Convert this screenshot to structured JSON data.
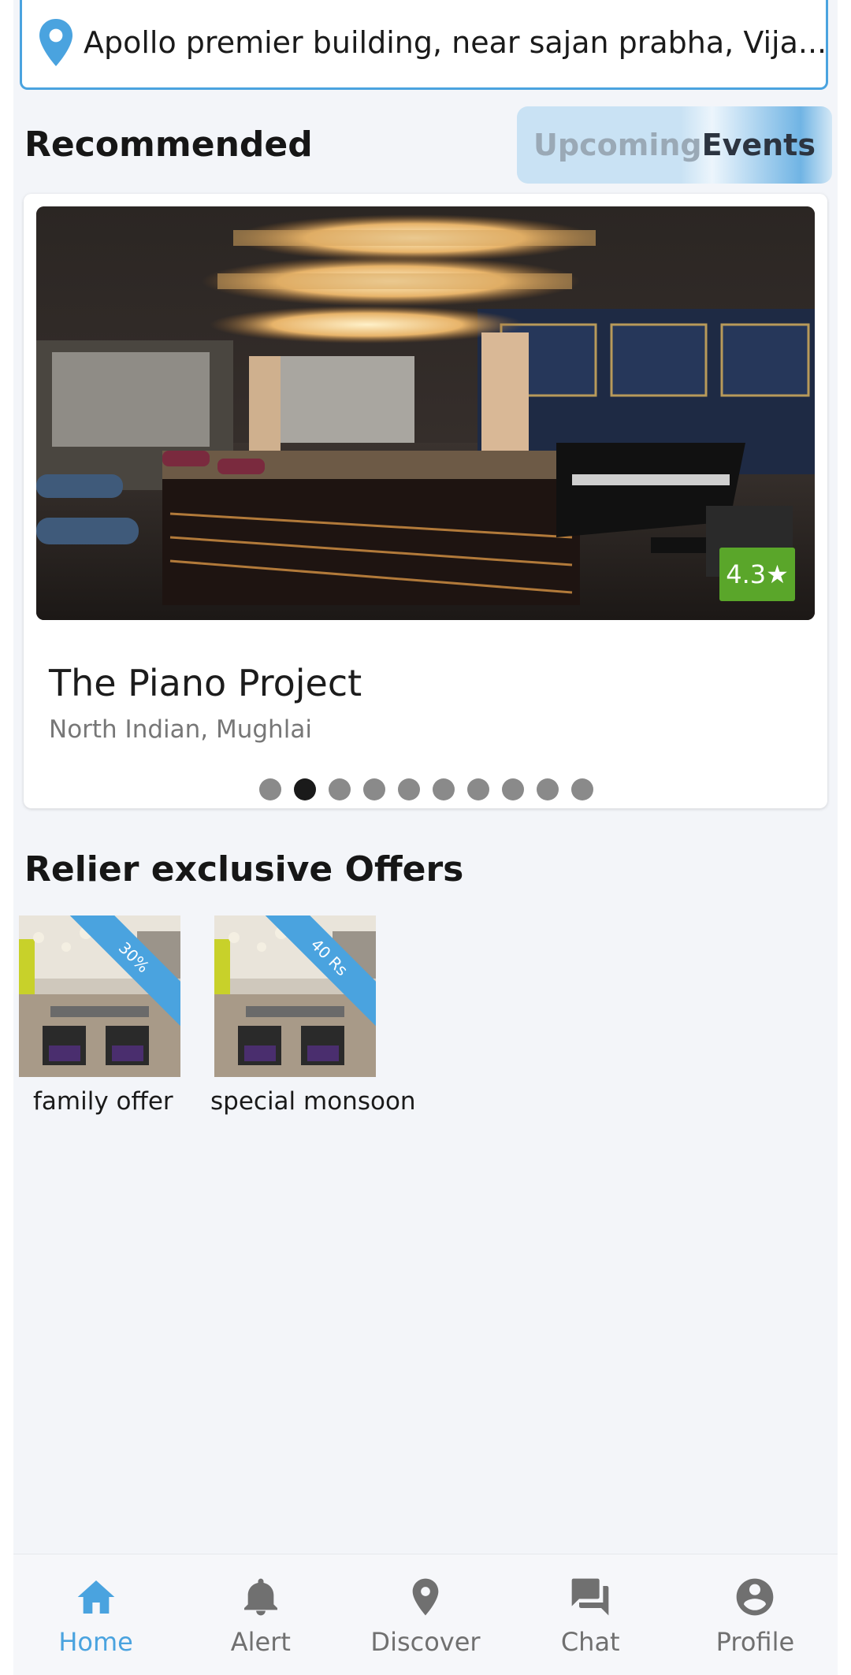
{
  "location": {
    "address": "Apollo premier building, near sajan prabha, Vija..."
  },
  "recommended": {
    "heading": "Recommended",
    "upcoming_events_part1": "Upcoming ",
    "upcoming_events_part2": "Events",
    "restaurant": {
      "name": "The Piano Project",
      "cuisine": "North Indian, Mughlai",
      "rating": "4.3★"
    },
    "carousel": {
      "total_slides": 10,
      "active_index": 1
    }
  },
  "offers": {
    "heading": "Relier exclusive Offers",
    "items": [
      {
        "title": "family offer",
        "tag": "30%"
      },
      {
        "title": "special monsoon",
        "tag": "40 Rs"
      }
    ]
  },
  "bottom_nav": {
    "items": [
      {
        "label": "Home",
        "icon": "home-icon",
        "active": true
      },
      {
        "label": "Alert",
        "icon": "bell-icon",
        "active": false
      },
      {
        "label": "Discover",
        "icon": "location-pin-icon",
        "active": false
      },
      {
        "label": "Chat",
        "icon": "chat-icon",
        "active": false
      },
      {
        "label": "Profile",
        "icon": "account-icon",
        "active": false
      }
    ]
  },
  "colors": {
    "accent": "#4aa3df",
    "rating_green": "#5aa62a",
    "background": "#f3f5f9"
  }
}
